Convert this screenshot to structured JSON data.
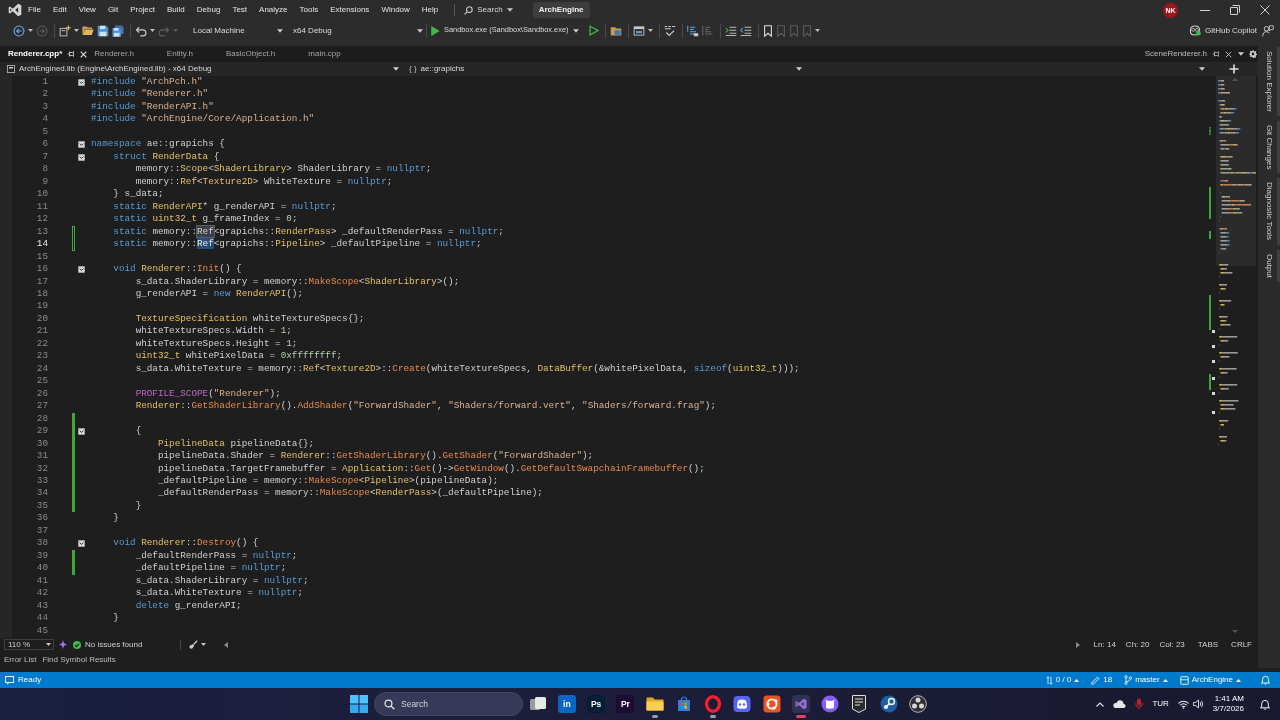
{
  "menu_bar": {
    "items": [
      "File",
      "Edit",
      "View",
      "Git",
      "Project",
      "Build",
      "Debug",
      "Test",
      "Analyze",
      "Tools",
      "Extensions",
      "Window",
      "Help"
    ],
    "search": "Search",
    "solution": "ArchEngine",
    "account": "NK"
  },
  "toolbar": {
    "target": "Local Machine",
    "configuration": "x64 Debug",
    "startup": "Sandbox.exe (Sandbox\\Sandbox.exe)",
    "copilot": "GitHub Copilot"
  },
  "document_tabs": [
    {
      "label": "Renderer.cpp*",
      "selected": true
    },
    {
      "label": "Renderer.h",
      "selected": false
    },
    {
      "label": "Entity.h",
      "selected": false
    },
    {
      "label": "BasicObject.h",
      "selected": false
    },
    {
      "label": "main.cpp",
      "selected": false
    }
  ],
  "preview_tab": {
    "label": "SceneRenderer.h"
  },
  "navigation_bar": {
    "project": "ArchEngined.lib (Engine\\ArchEngined.lib) - x64 Debug",
    "scope_glyph": "{ }",
    "scope": "ae::grapichs"
  },
  "editor": {
    "lines": [
      {
        "number": "1",
        "current": false,
        "foldable": true,
        "changed": false,
        "tokens": [
          {
            "text": "#include",
            "kind": "keyword"
          },
          {
            "text": " \"ArchPch.h\"",
            "kind": "string"
          }
        ]
      },
      {
        "number": "2",
        "current": false,
        "foldable": false,
        "changed": false,
        "tokens": [
          {
            "text": "#include",
            "kind": "keyword"
          },
          {
            "text": " \"Renderer.h\"",
            "kind": "string"
          }
        ]
      },
      {
        "number": "3",
        "current": false,
        "foldable": false,
        "changed": false,
        "tokens": [
          {
            "text": "#include",
            "kind": "keyword"
          },
          {
            "text": " \"RenderAPI.h\"",
            "kind": "string"
          }
        ]
      },
      {
        "number": "4",
        "current": false,
        "foldable": false,
        "changed": false,
        "tokens": [
          {
            "text": "#include",
            "kind": "keyword"
          },
          {
            "text": " \"ArchEngine/Core/Application.h\"",
            "kind": "string"
          }
        ]
      },
      {
        "number": "5",
        "current": false,
        "foldable": false,
        "changed": false
      },
      {
        "number": "6",
        "current": false,
        "foldable": true,
        "changed": false,
        "tokens": [
          {
            "text": "namespace",
            "kind": "keyword"
          },
          {
            "text": " ae::grapichs {",
            "kind": "plain"
          }
        ],
        "children": [
          {
            "number": "7",
            "current": false,
            "foldable": true,
            "changed": false,
            "tokens": [
              {
                "text": "struct",
                "kind": "keyword"
              },
              {
                "text": " RenderData",
                "kind": "type"
              },
              {
                "text": " {",
                "kind": "plain"
              }
            ],
            "children": [
              {
                "number": "8",
                "current": false,
                "foldable": false,
                "changed": false,
                "tokens": [
                  {
                    "text": "memory::",
                    "kind": "plain"
                  },
                  {
                    "text": "Scope",
                    "kind": "type"
                  },
                  {
                    "text": "<",
                    "kind": "plain"
                  },
                  {
                    "text": "ShaderLibrary",
                    "kind": "type"
                  },
                  {
                    "text": "> ShaderLibrary = ",
                    "kind": "plain"
                  },
                  {
                    "text": "nullptr",
                    "kind": "keyword"
                  },
                  {
                    "text": ";",
                    "kind": "plain"
                  }
                ]
              },
              {
                "number": "9",
                "current": false,
                "foldable": false,
                "changed": false,
                "tokens": [
                  {
                    "text": "memory::",
                    "kind": "plain"
                  },
                  {
                    "text": "Ref",
                    "kind": "type"
                  },
                  {
                    "text": "<",
                    "kind": "plain"
                  },
                  {
                    "text": "Texture2D",
                    "kind": "type"
                  },
                  {
                    "text": "> WhiteTexture = ",
                    "kind": "plain"
                  },
                  {
                    "text": "nullptr",
                    "kind": "keyword"
                  },
                  {
                    "text": ";",
                    "kind": "plain"
                  }
                ]
              }
            ]
          },
          {
            "number": "10",
            "current": false,
            "foldable": false,
            "changed": false,
            "tokens": [
              {
                "text": "} s_data;",
                "kind": "plain"
              }
            ]
          },
          {
            "number": "11",
            "current": false,
            "foldable": false,
            "changed": false,
            "tokens": [
              {
                "text": "static",
                "kind": "keyword"
              },
              {
                "text": " RenderAPI",
                "kind": "type"
              },
              {
                "text": "* g_renderAPI = ",
                "kind": "plain"
              },
              {
                "text": "nullptr",
                "kind": "keyword"
              },
              {
                "text": ";",
                "kind": "plain"
              }
            ]
          },
          {
            "number": "12",
            "current": false,
            "foldable": false,
            "changed": false,
            "tokens": [
              {
                "text": "static",
                "kind": "keyword"
              },
              {
                "text": " uint32_t",
                "kind": "type"
              },
              {
                "text": " g_frameIndex = ",
                "kind": "plain"
              },
              {
                "text": "0",
                "kind": "number"
              },
              {
                "text": ";",
                "kind": "plain"
              }
            ]
          },
          {
            "number": "13",
            "current": false,
            "foldable": false,
            "changed": true,
            "saved": false,
            "tokens": [
              {
                "text": "static",
                "kind": "keyword"
              },
              {
                "text": " memory::",
                "kind": "plain"
              },
              {
                "text": "Ref",
                "kind": "match"
              },
              {
                "text": "<grapichs::",
                "kind": "plain"
              },
              {
                "text": "RenderPass",
                "kind": "type"
              },
              {
                "text": "> _defaultRenderPass = ",
                "kind": "plain"
              },
              {
                "text": "nullptr",
                "kind": "keyword"
              },
              {
                "text": ";",
                "kind": "plain"
              }
            ]
          },
          {
            "number": "14",
            "current": true,
            "foldable": false,
            "changed": true,
            "saved": false,
            "tokens": [
              {
                "text": "static",
                "kind": "keyword"
              },
              {
                "text": " memory::",
                "kind": "plain"
              },
              {
                "text": "Ref",
                "kind": "selection"
              },
              {
                "text": "<grapichs::",
                "kind": "plain"
              },
              {
                "text": "Pipeline",
                "kind": "type"
              },
              {
                "text": "> _defaultPipeline = ",
                "kind": "plain"
              },
              {
                "text": "nullptr",
                "kind": "keyword"
              },
              {
                "text": ";",
                "kind": "plain"
              }
            ]
          },
          {
            "number": "15",
            "current": false,
            "foldable": false,
            "changed": false
          },
          {
            "number": "16",
            "current": false,
            "foldable": true,
            "changed": false,
            "tokens": [
              {
                "text": "void",
                "kind": "keyword"
              },
              {
                "text": " Renderer",
                "kind": "type"
              },
              {
                "text": "::",
                "kind": "plain"
              },
              {
                "text": "Init",
                "kind": "function"
              },
              {
                "text": "() {",
                "kind": "plain"
              }
            ],
            "children": [
              {
                "number": "17",
                "current": false,
                "foldable": false,
                "changed": false,
                "tokens": [
                  {
                    "text": "s_data.ShaderLibrary = memory::",
                    "kind": "plain"
                  },
                  {
                    "text": "MakeScope",
                    "kind": "function"
                  },
                  {
                    "text": "<",
                    "kind": "plain"
                  },
                  {
                    "text": "ShaderLibrary",
                    "kind": "type"
                  },
                  {
                    "text": ">();",
                    "kind": "plain"
                  }
                ]
              },
              {
                "number": "18",
                "current": false,
                "foldable": false,
                "changed": false,
                "tokens": [
                  {
                    "text": "g_renderAPI = ",
                    "kind": "plain"
                  },
                  {
                    "text": "new",
                    "kind": "keyword"
                  },
                  {
                    "text": " RenderAPI",
                    "kind": "type"
                  },
                  {
                    "text": "();",
                    "kind": "plain"
                  }
                ]
              },
              {
                "number": "19",
                "current": false,
                "foldable": false,
                "changed": false
              },
              {
                "number": "20",
                "current": false,
                "foldable": false,
                "changed": false,
                "tokens": [
                  {
                    "text": "TextureSpecification",
                    "kind": "type"
                  },
                  {
                    "text": " whiteTextureSpecs{};",
                    "kind": "plain"
                  }
                ]
              },
              {
                "number": "21",
                "current": false,
                "foldable": false,
                "changed": false,
                "tokens": [
                  {
                    "text": "whiteTextureSpecs.Width = ",
                    "kind": "plain"
                  },
                  {
                    "text": "1",
                    "kind": "number"
                  },
                  {
                    "text": ";",
                    "kind": "plain"
                  }
                ]
              },
              {
                "number": "22",
                "current": false,
                "foldable": false,
                "changed": false,
                "tokens": [
                  {
                    "text": "whiteTextureSpecs.Height = ",
                    "kind": "plain"
                  },
                  {
                    "text": "1",
                    "kind": "number"
                  },
                  {
                    "text": ";",
                    "kind": "plain"
                  }
                ]
              },
              {
                "number": "23",
                "current": false,
                "foldable": false,
                "changed": false,
                "tokens": [
                  {
                    "text": "uint32_t",
                    "kind": "type"
                  },
                  {
                    "text": " whitePixelData = ",
                    "kind": "plain"
                  },
                  {
                    "text": "0xffffffff",
                    "kind": "number"
                  },
                  {
                    "text": ";",
                    "kind": "plain"
                  }
                ]
              },
              {
                "number": "24",
                "current": false,
                "foldable": false,
                "changed": false,
                "tokens": [
                  {
                    "text": "s_data.WhiteTexture = memory::",
                    "kind": "plain"
                  },
                  {
                    "text": "Ref",
                    "kind": "type"
                  },
                  {
                    "text": "<",
                    "kind": "plain"
                  },
                  {
                    "text": "Texture2D",
                    "kind": "type"
                  },
                  {
                    "text": ">::",
                    "kind": "plain"
                  },
                  {
                    "text": "Create",
                    "kind": "function"
                  },
                  {
                    "text": "(whiteTextureSpecs, ",
                    "kind": "plain"
                  },
                  {
                    "text": "DataBuffer",
                    "kind": "type"
                  },
                  {
                    "text": "(&whitePixelData, ",
                    "kind": "plain"
                  },
                  {
                    "text": "sizeof",
                    "kind": "keyword"
                  },
                  {
                    "text": "(",
                    "kind": "plain"
                  },
                  {
                    "text": "uint32_t",
                    "kind": "type"
                  },
                  {
                    "text": ")));",
                    "kind": "plain"
                  }
                ]
              },
              {
                "number": "25",
                "current": false,
                "foldable": false,
                "changed": false
              },
              {
                "number": "26",
                "current": false,
                "foldable": false,
                "changed": false,
                "tokens": [
                  {
                    "text": "PROFILE_SCOPE",
                    "kind": "macro"
                  },
                  {
                    "text": "(",
                    "kind": "plain"
                  },
                  {
                    "text": "\"Renderer\"",
                    "kind": "string"
                  },
                  {
                    "text": ");",
                    "kind": "plain"
                  }
                ]
              },
              {
                "number": "27",
                "current": false,
                "foldable": false,
                "changed": false,
                "tokens": [
                  {
                    "text": "Renderer",
                    "kind": "type"
                  },
                  {
                    "text": "::",
                    "kind": "plain"
                  },
                  {
                    "text": "GetShaderLibrary",
                    "kind": "function"
                  },
                  {
                    "text": "().",
                    "kind": "plain"
                  },
                  {
                    "text": "AddShader",
                    "kind": "function"
                  },
                  {
                    "text": "(",
                    "kind": "plain"
                  },
                  {
                    "text": "\"ForwardShader\"",
                    "kind": "string"
                  },
                  {
                    "text": ", ",
                    "kind": "plain"
                  },
                  {
                    "text": "\"Shaders/forward.vert\"",
                    "kind": "string"
                  },
                  {
                    "text": ", ",
                    "kind": "plain"
                  },
                  {
                    "text": "\"Shaders/forward.frag\"",
                    "kind": "string"
                  },
                  {
                    "text": ");",
                    "kind": "plain"
                  }
                ]
              },
              {
                "number": "28",
                "current": false,
                "foldable": false,
                "changed": true,
                "saved": true
              },
              {
                "number": "29",
                "current": false,
                "foldable": true,
                "changed": true,
                "saved": true,
                "tokens": [
                  {
                    "text": "{",
                    "kind": "plain"
                  }
                ],
                "children": [
                  {
                    "number": "30",
                    "current": false,
                    "foldable": false,
                    "changed": true,
                    "saved": true,
                    "tokens": [
                      {
                        "text": "PipelineData",
                        "kind": "type"
                      },
                      {
                        "text": " pipelineData{};",
                        "kind": "plain"
                      }
                    ]
                  },
                  {
                    "number": "31",
                    "current": false,
                    "foldable": false,
                    "changed": true,
                    "saved": true,
                    "tokens": [
                      {
                        "text": "pipelineData.Shader = ",
                        "kind": "plain"
                      },
                      {
                        "text": "Renderer",
                        "kind": "type"
                      },
                      {
                        "text": "::",
                        "kind": "plain"
                      },
                      {
                        "text": "GetShaderLibrary",
                        "kind": "function"
                      },
                      {
                        "text": "().",
                        "kind": "plain"
                      },
                      {
                        "text": "GetShader",
                        "kind": "function"
                      },
                      {
                        "text": "(",
                        "kind": "plain"
                      },
                      {
                        "text": "\"ForwardShader\"",
                        "kind": "string"
                      },
                      {
                        "text": ");",
                        "kind": "plain"
                      }
                    ]
                  },
                  {
                    "number": "32",
                    "current": false,
                    "foldable": false,
                    "changed": true,
                    "saved": true,
                    "tokens": [
                      {
                        "text": "pipelineData.TargetFramebuffer = ",
                        "kind": "plain"
                      },
                      {
                        "text": "Application",
                        "kind": "type"
                      },
                      {
                        "text": "::",
                        "kind": "plain"
                      },
                      {
                        "text": "Get",
                        "kind": "function"
                      },
                      {
                        "text": "()->",
                        "kind": "plain"
                      },
                      {
                        "text": "GetWindow",
                        "kind": "function"
                      },
                      {
                        "text": "().",
                        "kind": "plain"
                      },
                      {
                        "text": "GetDefaultSwapchainFramebuffer",
                        "kind": "function"
                      },
                      {
                        "text": "();",
                        "kind": "plain"
                      }
                    ]
                  },
                  {
                    "number": "33",
                    "current": false,
                    "foldable": false,
                    "changed": true,
                    "saved": true,
                    "tokens": [
                      {
                        "text": "_defaultPipeline = memory::",
                        "kind": "plain"
                      },
                      {
                        "text": "MakeScope",
                        "kind": "function"
                      },
                      {
                        "text": "<",
                        "kind": "plain"
                      },
                      {
                        "text": "Pipeline",
                        "kind": "type"
                      },
                      {
                        "text": ">(pipelineData);",
                        "kind": "plain"
                      }
                    ]
                  },
                  {
                    "number": "34",
                    "current": false,
                    "foldable": false,
                    "changed": true,
                    "saved": true,
                    "tokens": [
                      {
                        "text": "_defaultRenderPass = memory::",
                        "kind": "plain"
                      },
                      {
                        "text": "MakeScope",
                        "kind": "function"
                      },
                      {
                        "text": "<",
                        "kind": "plain"
                      },
                      {
                        "text": "RenderPass",
                        "kind": "type"
                      },
                      {
                        "text": ">(_defaultPipeline);",
                        "kind": "plain"
                      }
                    ]
                  }
                ]
              },
              {
                "number": "35",
                "current": false,
                "foldable": false,
                "changed": true,
                "saved": true,
                "tokens": [
                  {
                    "text": "}",
                    "kind": "plain"
                  }
                ]
              }
            ]
          },
          {
            "number": "36",
            "current": false,
            "foldable": false,
            "changed": false,
            "tokens": [
              {
                "text": "}",
                "kind": "plain"
              }
            ]
          },
          {
            "number": "37",
            "current": false,
            "foldable": false,
            "changed": false
          },
          {
            "number": "38",
            "current": false,
            "foldable": true,
            "changed": false,
            "tokens": [
              {
                "text": "void",
                "kind": "keyword"
              },
              {
                "text": " Renderer",
                "kind": "type"
              },
              {
                "text": "::",
                "kind": "plain"
              },
              {
                "text": "Destroy",
                "kind": "function"
              },
              {
                "text": "() {",
                "kind": "plain"
              }
            ],
            "children": [
              {
                "number": "39",
                "current": false,
                "foldable": false,
                "changed": true,
                "saved": true,
                "tokens": [
                  {
                    "text": "_defaultRenderPass = ",
                    "kind": "plain"
                  },
                  {
                    "text": "nullptr",
                    "kind": "keyword"
                  },
                  {
                    "text": ";",
                    "kind": "plain"
                  }
                ]
              },
              {
                "number": "40",
                "current": false,
                "foldable": false,
                "changed": true,
                "saved": true,
                "tokens": [
                  {
                    "text": "_defaultPipeline = ",
                    "kind": "plain"
                  },
                  {
                    "text": "nullptr",
                    "kind": "keyword"
                  },
                  {
                    "text": ";",
                    "kind": "plain"
                  }
                ]
              },
              {
                "number": "41",
                "current": false,
                "foldable": false,
                "changed": false,
                "tokens": [
                  {
                    "text": "s_data.ShaderLibrary = ",
                    "kind": "plain"
                  },
                  {
                    "text": "nullptr",
                    "kind": "keyword"
                  },
                  {
                    "text": ";",
                    "kind": "plain"
                  }
                ]
              },
              {
                "number": "42",
                "current": false,
                "foldable": false,
                "changed": false,
                "tokens": [
                  {
                    "text": "s_data.WhiteTexture = ",
                    "kind": "plain"
                  },
                  {
                    "text": "nullptr",
                    "kind": "keyword"
                  },
                  {
                    "text": ";",
                    "kind": "plain"
                  }
                ]
              },
              {
                "number": "43",
                "current": false,
                "foldable": false,
                "changed": false,
                "tokens": [
                  {
                    "text": "delete",
                    "kind": "keyword"
                  },
                  {
                    "text": " g_renderAPI;",
                    "kind": "plain"
                  }
                ]
              }
            ]
          },
          {
            "number": "44",
            "current": false,
            "foldable": false,
            "changed": false,
            "tokens": [
              {
                "text": "}",
                "kind": "plain"
              }
            ]
          },
          {
            "number": "45",
            "current": false,
            "foldable": false,
            "changed": false
          }
        ]
      }
    ]
  },
  "editor_status": {
    "zoom": "110 %",
    "issues": "No issues found",
    "line": "Ln: 14",
    "character": "Ch: 20",
    "column": "Col: 23",
    "indentation": "TABS",
    "line_ending": "CRLF"
  },
  "bottom_tabs": [
    {
      "label": "Error List",
      "selected": false
    },
    {
      "label": "Find Symbol Results",
      "selected": false
    }
  ],
  "tool_window_tabs": [
    "Solution Explorer",
    "Git Changes",
    "Diagnostic Tools",
    "Output"
  ],
  "status_bar": {
    "message": "Ready",
    "commits": "0 / 0",
    "changes": "18",
    "branch": "master",
    "repository": "ArchEngine"
  },
  "taskbar": {
    "search": "Search",
    "apps": [
      {
        "kind": "task-view",
        "running": false,
        "active": false
      },
      {
        "kind": "tile",
        "label": "in",
        "color": "#0a66c2",
        "running": false,
        "active": false
      },
      {
        "kind": "tile",
        "label": "Ps",
        "color": "#001e36",
        "running": false,
        "active": false
      },
      {
        "kind": "tile",
        "label": "Pr",
        "color": "#1f0a33",
        "running": false,
        "active": false
      },
      {
        "kind": "folder",
        "running": true,
        "active": false
      },
      {
        "kind": "store",
        "running": false,
        "active": false
      },
      {
        "kind": "opera",
        "running": true,
        "active": false
      },
      {
        "kind": "discord",
        "running": false,
        "active": false
      },
      {
        "kind": "ring-tile",
        "running": false,
        "active": false
      },
      {
        "kind": "visual-studio",
        "running": true,
        "active": true
      },
      {
        "kind": "github",
        "running": false,
        "active": false
      },
      {
        "kind": "epic",
        "running": false,
        "active": false
      },
      {
        "kind": "steam",
        "running": false,
        "active": false
      },
      {
        "kind": "obs",
        "running": false,
        "active": false
      }
    ],
    "language": "TUR",
    "time": "1:41 AM",
    "date": "3/7/2026"
  }
}
